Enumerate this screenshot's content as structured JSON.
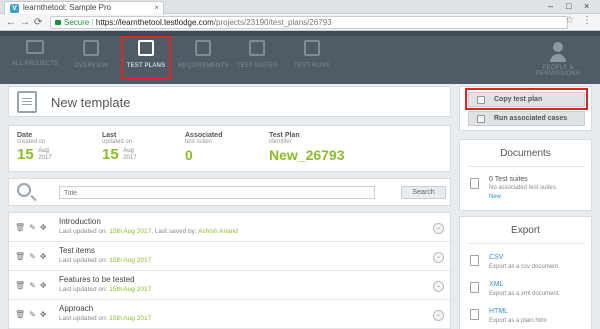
{
  "browser": {
    "tab_title": "learnthetool: Sample Pro",
    "tab_close": "×",
    "window_controls": [
      "–",
      "□",
      "×"
    ],
    "secure_label": "Secure",
    "url_scheme_domain": "https://learnthetool.testlodge.com",
    "url_path": "/projects/23190/test_plans/26793"
  },
  "nav": {
    "items": [
      {
        "label": "ALL PROJECTS",
        "icon": "folder-icon"
      },
      {
        "label": "OVERVIEW",
        "icon": "presentation-icon"
      },
      {
        "label": "TEST PLANS",
        "icon": "test-plan-icon",
        "active": true
      },
      {
        "label": "REQUIREMENTS",
        "icon": "requirements-icon"
      },
      {
        "label": "TEST SUITES",
        "icon": "test-suites-icon"
      },
      {
        "label": "TEST RUNS",
        "icon": "test-runs-icon"
      }
    ],
    "people_label_1": "PEOPLE &",
    "people_label_2": "PERMISSIONS"
  },
  "page": {
    "title": "New template"
  },
  "info": {
    "date_label": "Date",
    "date_sub": "created on",
    "date_day": "15",
    "date_month": "Aug",
    "date_year": "2017",
    "last_label": "Last",
    "last_sub": "updated on",
    "last_day": "15",
    "last_month": "Aug",
    "last_year": "2017",
    "assoc_label": "Associated",
    "assoc_sub": "test suites",
    "assoc_value": "0",
    "plan_label": "Test Plan",
    "plan_sub": "identifier",
    "plan_value": "New_26793"
  },
  "search": {
    "placeholder": "Title",
    "button_label": "Search"
  },
  "sections": [
    {
      "title": "Introduction",
      "meta_prefix": "Last updated on: ",
      "date": "15th Aug 2017",
      "saved_prefix": ", Last saved by: ",
      "saved_by": "Ashish Anand"
    },
    {
      "title": "Test items",
      "meta_prefix": "Last updated on: ",
      "date": "15th Aug 2017"
    },
    {
      "title": "Features to be tested",
      "meta_prefix": "Last updated on: ",
      "date": "15th Aug 2017"
    },
    {
      "title": "Approach",
      "meta_prefix": "Last updated on: ",
      "date": "15th Aug 2017"
    }
  ],
  "actions": {
    "copy_label": "Copy test plan",
    "run_label": "Run associated cases"
  },
  "documents": {
    "title": "Documents",
    "count_text": "0 Test suites",
    "none_text": "No associated test suites.",
    "new_link": "New"
  },
  "export": {
    "title": "Export",
    "items": [
      {
        "name": "CSV",
        "desc": "Export as a csv document."
      },
      {
        "name": "XML",
        "desc": "Export as a xml document."
      },
      {
        "name": "HTML",
        "desc": "Export as a plain html"
      }
    ]
  },
  "colors": {
    "accent_green": "#8cbb2b",
    "nav_bg": "#4f5c66",
    "highlight_red": "#e02424",
    "link_blue": "#3a8fcd"
  }
}
